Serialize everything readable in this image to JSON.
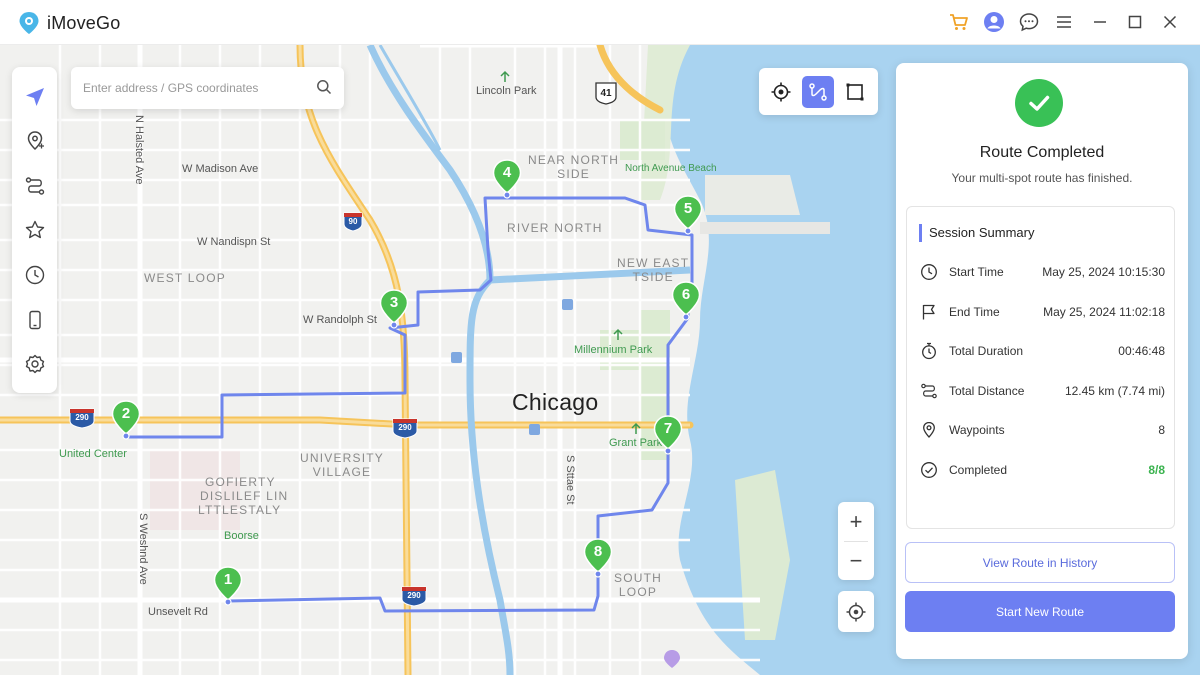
{
  "app": {
    "title": "iMoveGo"
  },
  "search": {
    "placeholder": "Enter address / GPS coordinates"
  },
  "map_labels": {
    "city": "Chicago",
    "lincoln_park": "Lincoln Park",
    "near_north_side": "NEAR NORTH\nSIDE",
    "north_avenue_beach": "North Avenue Beach",
    "river_north": "RIVER NORTH",
    "new_east_side": "NEW EAST\nTSIDE",
    "w_madison_ave": "W Madison Ave",
    "w_nandispn_st": "W Nandispn St",
    "west_loop": "WEST LOOP",
    "w_randolph_st": "W Randolph St",
    "millennium_park": "Millennium Park",
    "united_center": "United Center",
    "university_village": "UNIVERSITY\nVILLAGE",
    "gofierty": "GOFIERTY",
    "district_blurred": "DISLILEF LIN",
    "lttlestaly": "LTTLESTALY",
    "boorse": "Boorse",
    "grant_park": "Grant Park",
    "s_state_st": "S Sttae St",
    "n_halsted_ave": "N Halsted Ave",
    "s_weshnd_ave": "S Weshnd Ave",
    "unsevelt_rd": "Unsevelt Rd",
    "south_loop": "SOUTH\nLOOP",
    "shield_41": "41",
    "shield_90": "90",
    "shield_290_a": "290",
    "shield_290_b": "290",
    "shield_290_c": "290"
  },
  "waypoints": [
    "1",
    "2",
    "3",
    "4",
    "5",
    "6",
    "7",
    "8"
  ],
  "zoom": {
    "in": "+",
    "out": "−"
  },
  "panel": {
    "title": "Route Completed",
    "subtitle": "Your multi-spot route has finished.",
    "summary_title": "Session Summary",
    "rows": [
      {
        "label": "Start Time",
        "value": "May 25, 2024 10:15:30",
        "icon": "clock-icon"
      },
      {
        "label": "End Time",
        "value": "May 25, 2024 11:02:18",
        "icon": "flag-icon"
      },
      {
        "label": "Total Duration",
        "value": "00:46:48",
        "icon": "stopwatch-icon"
      },
      {
        "label": "Total Distance",
        "value": "12.45 km (7.74 mi)",
        "icon": "route-icon"
      },
      {
        "label": "Waypoints",
        "value": "8",
        "icon": "pin-icon"
      },
      {
        "label": "Completed",
        "value": "8/8",
        "icon": "check-circle-icon"
      }
    ],
    "view_history_label": "View Route in History",
    "start_new_label": "Start New Route"
  },
  "colors": {
    "accent": "#6d7ff2",
    "success": "#39c156",
    "route": "#6f86ec",
    "water": "#a9d3f0",
    "pin": "#4cbf4f"
  }
}
